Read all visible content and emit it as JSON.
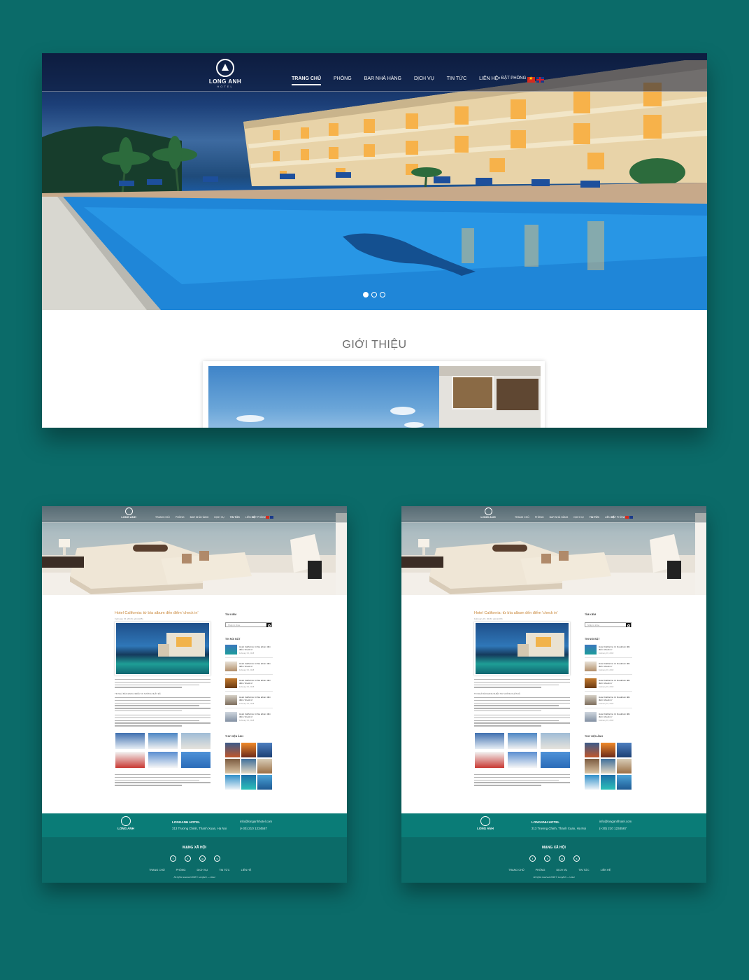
{
  "main_page": {
    "logo": {
      "name": "LONG ANH",
      "sub": "HOTEL"
    },
    "nav": [
      "TRANG CHỦ",
      "PHÒNG",
      "BAR NHÀ HÀNG",
      "DỊCH VỤ",
      "TIN TỨC",
      "LIÊN HỆ"
    ],
    "active_nav": "TRANG CHỦ",
    "booking": "♦ ĐẶT PHÒNG",
    "languages": [
      "vi",
      "en"
    ],
    "slider": {
      "dots": 3,
      "active": 1
    },
    "intro_title": "GIỚI THIỆU"
  },
  "article_page": {
    "logo": {
      "name": "LONG ANH",
      "sub": "HOTEL"
    },
    "nav": [
      "TRANG CHỦ",
      "PHÒNG",
      "BAR NHÀ HÀNG",
      "DỊCH VỤ",
      "TIN TỨC",
      "LIÊN HỆ"
    ],
    "active_nav": "TIN TỨC",
    "booking": "ĐẶT PHÒNG",
    "post": {
      "title": "Hotel California: từ bìa album đến điểm 'check in'",
      "meta": "February 15, 2018   |   admin(05)",
      "subheading": "TIN NHÀ BÁO ĐANG NHIỀU TAI SƯỚNG NHẤT ĐÂ"
    },
    "sidebar": {
      "search_heading": "TÌM KIẾM",
      "search_placeholder": "Nhập từ khóa",
      "news_heading": "TIN NỔI BẬT",
      "news": [
        {
          "title": "Hotel California: từ bìa album đến điểm 'check in'",
          "date": "February 15, 2018"
        },
        {
          "title": "Hotel California: từ bìa album đến điểm 'check in'",
          "date": "February 15, 2018"
        },
        {
          "title": "Hotel California: từ bìa album đến điểm 'check in'",
          "date": "February 15, 2018"
        },
        {
          "title": "Hotel California: từ bìa album đến điểm 'check in'",
          "date": "February 15, 2018"
        },
        {
          "title": "Hotel California: từ bìa album đến điểm 'check in'",
          "date": "February 15, 2018"
        }
      ],
      "library_heading": "THƯ VIỆN ẢNH"
    },
    "footer": {
      "logo_name": "LONG ANH",
      "hotel_name": "LONGANH HOTEL",
      "address": "313 Trương Chinh, Thanh Xuan, Ha Noi",
      "email": "info@longanhhotel.com",
      "phone": "(+30) 210 1234567",
      "social_heading": "MẠNG XÃ HỘI",
      "social_icons": [
        "facebook-icon",
        "twitter-icon",
        "google-plus-icon",
        "skype-icon"
      ],
      "menu": [
        "TRANG CHỦ",
        "PHÒNG",
        "DỊCH VỤ",
        "TIN TỨC",
        "LIÊN HỆ"
      ],
      "copyright": "All rights reserved 2018 © LongAnh — Hotel"
    }
  },
  "colors": {
    "background": "#0b6b69",
    "footer": "#0a7c77",
    "accent_title": "#c9873a"
  }
}
